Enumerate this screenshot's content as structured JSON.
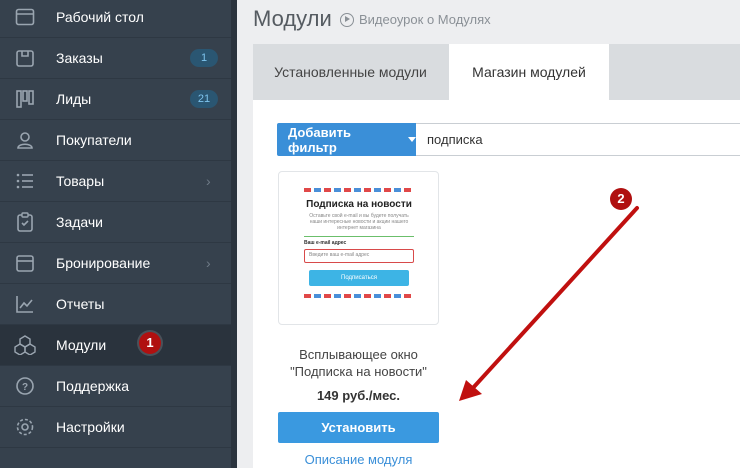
{
  "sidebar": {
    "items": [
      {
        "label": "Рабочий стол",
        "icon": "desktop-icon"
      },
      {
        "label": "Заказы",
        "icon": "box-icon",
        "count": "1"
      },
      {
        "label": "Лиды",
        "icon": "kanban-icon",
        "count": "21"
      },
      {
        "label": "Покупатели",
        "icon": "user-icon"
      },
      {
        "label": "Товары",
        "icon": "list-icon"
      },
      {
        "label": "Задачи",
        "icon": "clipboard-icon"
      },
      {
        "label": "Бронирование",
        "icon": "calendar-icon"
      },
      {
        "label": "Отчеты",
        "icon": "chart-icon"
      },
      {
        "label": "Модули",
        "icon": "cubes-icon"
      },
      {
        "label": "Поддержка",
        "icon": "help-icon"
      },
      {
        "label": "Настройки",
        "icon": "gear-icon"
      }
    ],
    "active": "Модули",
    "marker": "1"
  },
  "header": {
    "title": "Модули",
    "video_link": "Видеоурок о Модулях"
  },
  "tabs": [
    {
      "label": "Установленные модули"
    },
    {
      "label": "Магазин модулей",
      "active": true
    }
  ],
  "filter": {
    "button_label": "Добавить фильтр",
    "search_value": "подписка"
  },
  "module": {
    "preview_title": "Подписка на новости",
    "preview_text": "Оставьте свой e-mail и вы будете получать наши интересные новости и акции нашего интернет магазина",
    "preview_label": "Ваш e-mail адрес",
    "preview_placeholder": "Введите ваш e-mail адрес",
    "preview_button": "Подписаться",
    "name_line1": "Всплывающее окно",
    "name_line2": "\"Подписка на новости\"",
    "price": "149 руб./мес.",
    "install_label": "Установить",
    "description_link": "Описание модуля"
  },
  "annotations": {
    "marker2": "2",
    "arrow_color": "#c0100f"
  }
}
